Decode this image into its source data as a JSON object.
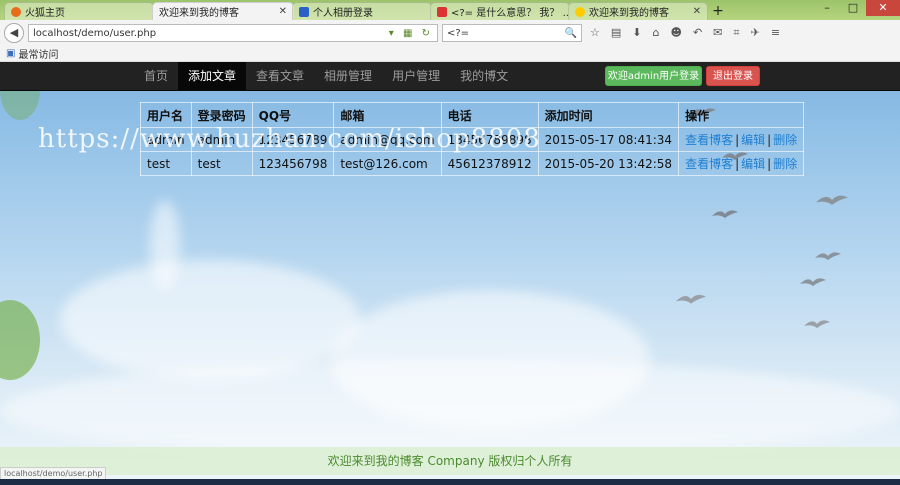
{
  "browser": {
    "tabs": [
      {
        "label": "火狐主页",
        "color": "#e86b1c",
        "active": false
      },
      {
        "label": "欢迎来到我的博客",
        "color": "#4a90d9",
        "active": true
      },
      {
        "label": "个人相册登录",
        "color": "#2a60c8",
        "active": false
      },
      {
        "label": "<?= 是什么意思？ 我？ ...",
        "color": "#d33",
        "active": false
      },
      {
        "label": "欢迎来到我的博客",
        "color": "#ffcc00",
        "active": false
      }
    ],
    "new_tab": "+",
    "win_controls": {
      "minimize": "–",
      "maximize": "□",
      "close": "✕"
    },
    "url": "localhost/demo/user.php",
    "search_value": "<?=",
    "bookmarks_label": "最常访问",
    "status_url": "localhost/demo/user.php"
  },
  "nav": {
    "items": [
      "首页",
      "添加文章",
      "查看文章",
      "相册管理",
      "用户管理",
      "我的博文"
    ],
    "active_index": 1,
    "admin_button": "欢迎admin用户登录",
    "logout_button": "退出登录"
  },
  "table": {
    "headers": [
      "用户名",
      "登录密码",
      "QQ号",
      "邮箱",
      "电话",
      "添加时间",
      "操作"
    ],
    "rows": [
      {
        "username": "admin",
        "password": "admin",
        "qq": "123456789",
        "email": "admin@qq.com",
        "phone": "13456789898",
        "added": "2015-05-17 08:41:34",
        "actions": [
          "查看博客",
          "编辑",
          "删除"
        ]
      },
      {
        "username": "test",
        "password": "test",
        "qq": "123456798",
        "email": "test@126.com",
        "phone": "45612378912",
        "added": "2015-05-20 13:42:58",
        "actions": [
          "查看博客",
          "编辑",
          "删除"
        ]
      }
    ],
    "action_separator": "|"
  },
  "watermark": "https://www.huzhan.com/ishop8808",
  "footer": "欢迎来到我的博客 Company 版权归个人所有",
  "colors": {
    "nav_bg": "#222222",
    "success": "#5cb85c",
    "danger": "#d9534f",
    "link": "#1f7fd1",
    "footer_text": "#4a8a2e"
  }
}
